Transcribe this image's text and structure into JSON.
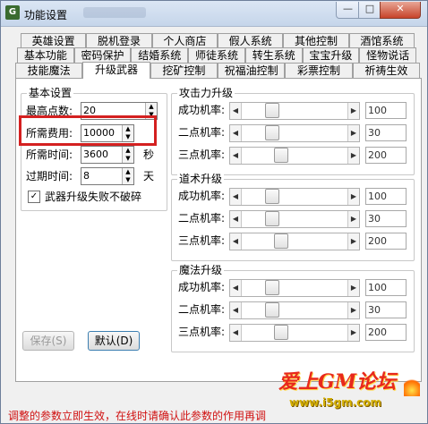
{
  "window": {
    "title": "功能设置",
    "icon": "game-app-icon",
    "controls": {
      "minimize": "—",
      "maximize": "□",
      "close": "✕"
    }
  },
  "tabs_row1": [
    "英雄设置",
    "脱机登录",
    "个人商店",
    "假人系统",
    "其他控制",
    "酒馆系统"
  ],
  "tabs_row2": [
    "基本功能",
    "密码保护",
    "结婚系统",
    "师徒系统",
    "转生系统",
    "宝宝升级",
    "怪物说话"
  ],
  "tabs_row3": [
    "技能魔法",
    "升级武器",
    "挖矿控制",
    "祝福油控制",
    "彩票控制",
    "祈祷生效"
  ],
  "active_tab": "升级武器",
  "basic": {
    "title": "基本设置",
    "max_points_label": "最高点数:",
    "max_points": "20",
    "cost_label": "所需费用:",
    "cost": "10000",
    "time_label": "所需时间:",
    "time": "3600",
    "time_unit": "秒",
    "expire_label": "过期时间:",
    "expire": "8",
    "expire_unit": "天",
    "no_break_label": "武器升级失败不破碎",
    "no_break_checked": "✓"
  },
  "sections": [
    {
      "title": "攻击力升级",
      "rows": [
        {
          "label": "成功机率:",
          "value": "100",
          "level": 0.25
        },
        {
          "label": "二点机率:",
          "value": "30",
          "level": 0.25
        },
        {
          "label": "三点机率:",
          "value": "200",
          "level": 0.35
        }
      ]
    },
    {
      "title": "道术升级",
      "rows": [
        {
          "label": "成功机率:",
          "value": "100",
          "level": 0.25
        },
        {
          "label": "二点机率:",
          "value": "30",
          "level": 0.25
        },
        {
          "label": "三点机率:",
          "value": "200",
          "level": 0.35
        }
      ]
    },
    {
      "title": "魔法升级",
      "rows": [
        {
          "label": "成功机率:",
          "value": "100",
          "level": 0.25
        },
        {
          "label": "二点机率:",
          "value": "30",
          "level": 0.25
        },
        {
          "label": "三点机率:",
          "value": "200",
          "level": 0.35
        }
      ]
    }
  ],
  "buttons": {
    "save": "保存(S)",
    "default": "默认(D)"
  },
  "status": "调整的参数立即生效，在线时请确认此参数的作用再调",
  "watermark": {
    "main": "爱上GM论坛",
    "sub": "www.i5gm.com"
  },
  "colors": {
    "status_text": "#d01010",
    "highlight": "#d42020",
    "watermark": "#e8281c"
  }
}
